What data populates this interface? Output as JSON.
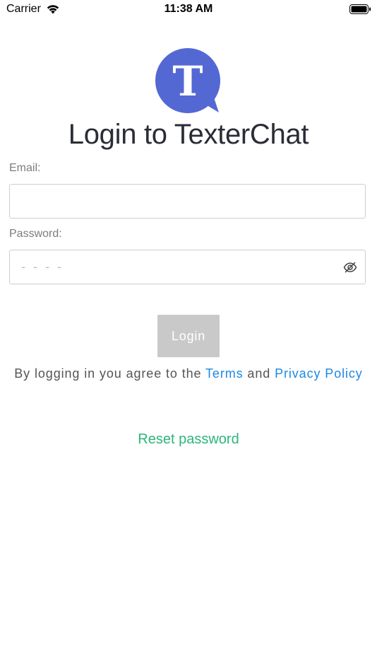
{
  "status_bar": {
    "carrier": "Carrier",
    "time": "11:38 AM",
    "icons": [
      "wifi-icon",
      "battery-icon"
    ]
  },
  "logo": {
    "letter": "T",
    "color": "#5468d4"
  },
  "title": "Login to TexterChat",
  "email": {
    "label": "Email:",
    "value": "",
    "placeholder": ""
  },
  "password": {
    "label": "Password:",
    "value": "",
    "placeholder": "- - - -",
    "toggle_icon": "eye-off-icon"
  },
  "login_button": {
    "label": "Login",
    "color": "#c9c9c9"
  },
  "terms": {
    "prefix": "By logging in you agree to the ",
    "terms_link": "Terms",
    "middle": " and ",
    "privacy_link": "Privacy Policy",
    "link_color": "#1e88e5"
  },
  "reset_password": {
    "label": "Reset password",
    "color": "#2db57a"
  }
}
